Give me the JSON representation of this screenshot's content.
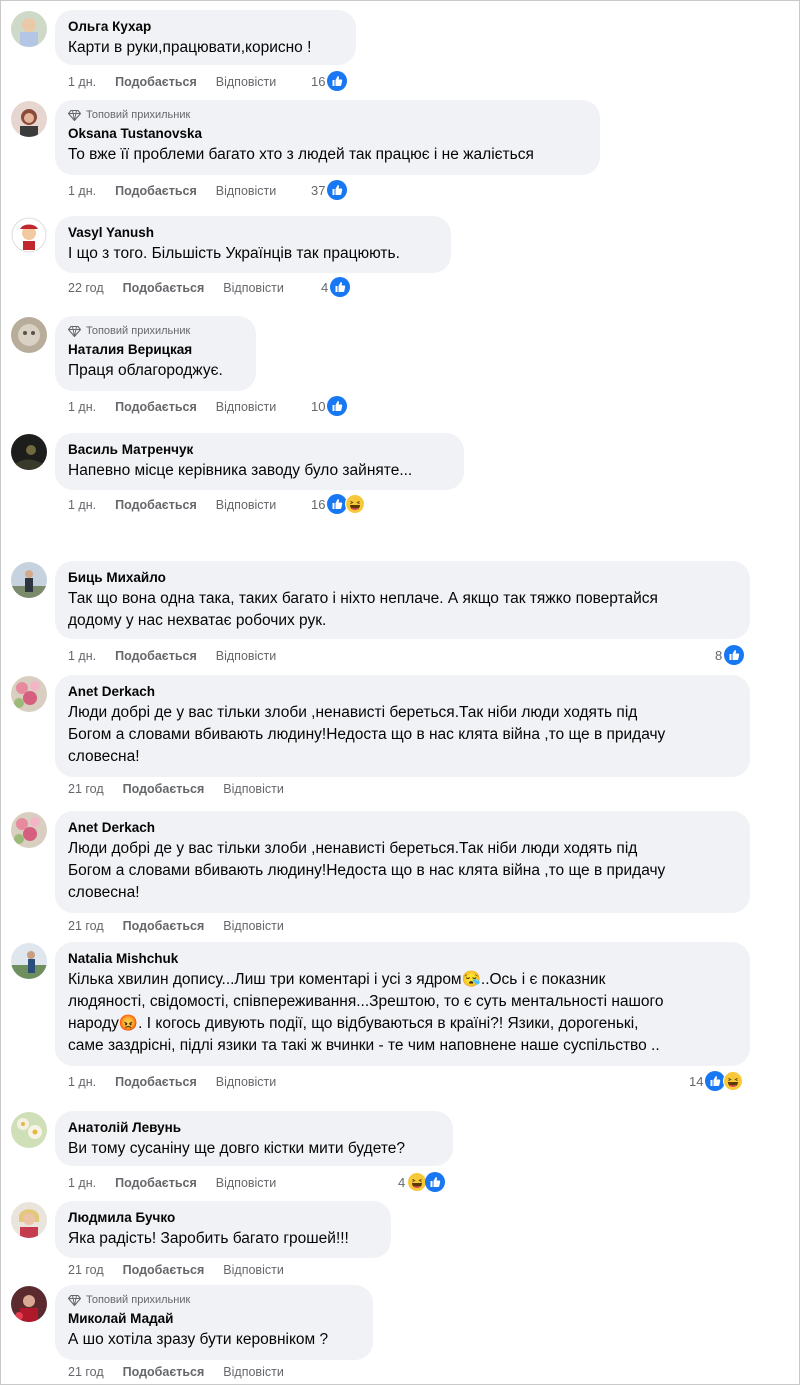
{
  "labels": {
    "like": "Подобається",
    "reply": "Відповісти",
    "top_fan": "Топовий прихильник"
  },
  "comments": [
    {
      "name": "Ольга Кухар",
      "text": "Карти в руки,працювати,корисно !",
      "time": "1 дн.",
      "count": "16",
      "reactions": [
        "like"
      ],
      "top_fan": false
    },
    {
      "name": "Oksana Tustanovska",
      "text": "То вже її проблеми багато хто з людей так працює і не жаліється",
      "time": "1 дн.",
      "count": "37",
      "reactions": [
        "like"
      ],
      "top_fan": true
    },
    {
      "name": "Vasyl Yanush",
      "text": "І що з того. Більшість Українців так працюють.",
      "time": "22 год",
      "count": "4",
      "reactions": [
        "like"
      ],
      "top_fan": false
    },
    {
      "name": "Наталия Верицкая",
      "text": "Праця облагороджує.",
      "time": "1 дн.",
      "count": "10",
      "reactions": [
        "like"
      ],
      "top_fan": true
    },
    {
      "name": "Василь Матренчук",
      "text": "Напевно місце керівника заводу було зайняте...",
      "time": "1 дн.",
      "count": "16",
      "reactions": [
        "like",
        "haha"
      ],
      "top_fan": false
    },
    {
      "name": "Биць Михайло",
      "text": "Так що вона одна така, таких багато і ніхто неплаче. А якщо так тяжко повертайся\nдодому у нас нехватає робочих рук.",
      "time": "1 дн.",
      "count": "8",
      "reactions": [
        "like"
      ],
      "top_fan": false
    },
    {
      "name": "Anet Derkach",
      "text": "Люди добрі де у вас тільки злоби ,ненависті береться.Так ніби люди ходять під\nБогом а словами вбивають людину!Недоста що в нас клята війна ,то ще в придачу\nсловесна!",
      "time": "21 год",
      "count": "",
      "reactions": [],
      "top_fan": false
    },
    {
      "name": "Anet Derkach",
      "text": "Люди добрі де у вас тільки злоби ,ненависті береться.Так ніби люди ходять під\nБогом а словами вбивають людину!Недоста що в нас клята війна ,то ще в придачу\nсловесна!",
      "time": "21 год",
      "count": "",
      "reactions": [],
      "top_fan": false
    },
    {
      "name": "Natalia Mishchuk",
      "text": "Кілька хвилин допису...Лиш три коментарі і усі з ядром😪..Ось і є показник\nлюдяності, свідомості, співпереживання...Зрештою, то є суть ментальності нашого\nнароду😡. І когось дивують події, що відбуваються в країні?! Язики, дорогенькі,\nсаме заздрісні, підлі язики та такі ж вчинки - те чим наповнене наше суспільство ..",
      "time": "1 дн.",
      "count": "14",
      "reactions": [
        "like",
        "haha"
      ],
      "top_fan": false
    },
    {
      "name": "Анатолій Левунь",
      "text": "Ви тому сусаніну ще довго кістки мити будете?",
      "time": "1 дн.",
      "count": "4",
      "reactions": [
        "haha",
        "like"
      ],
      "top_fan": false
    },
    {
      "name": "Людмила Бучко",
      "text": "Яка радість! Заробить багато грошей!!!",
      "time": "21 год",
      "count": "",
      "reactions": [],
      "top_fan": false
    },
    {
      "name": "Миколай Мадай",
      "text": "А шо хотіла зразу бути керовніком ?",
      "time": "21 год",
      "count": "",
      "reactions": [],
      "top_fan": true
    }
  ],
  "colors": {
    "like_blue": "#1877f2",
    "haha_yellow": "#f7c93a",
    "bubble": "#f0f2f5",
    "meta": "#65676b"
  }
}
